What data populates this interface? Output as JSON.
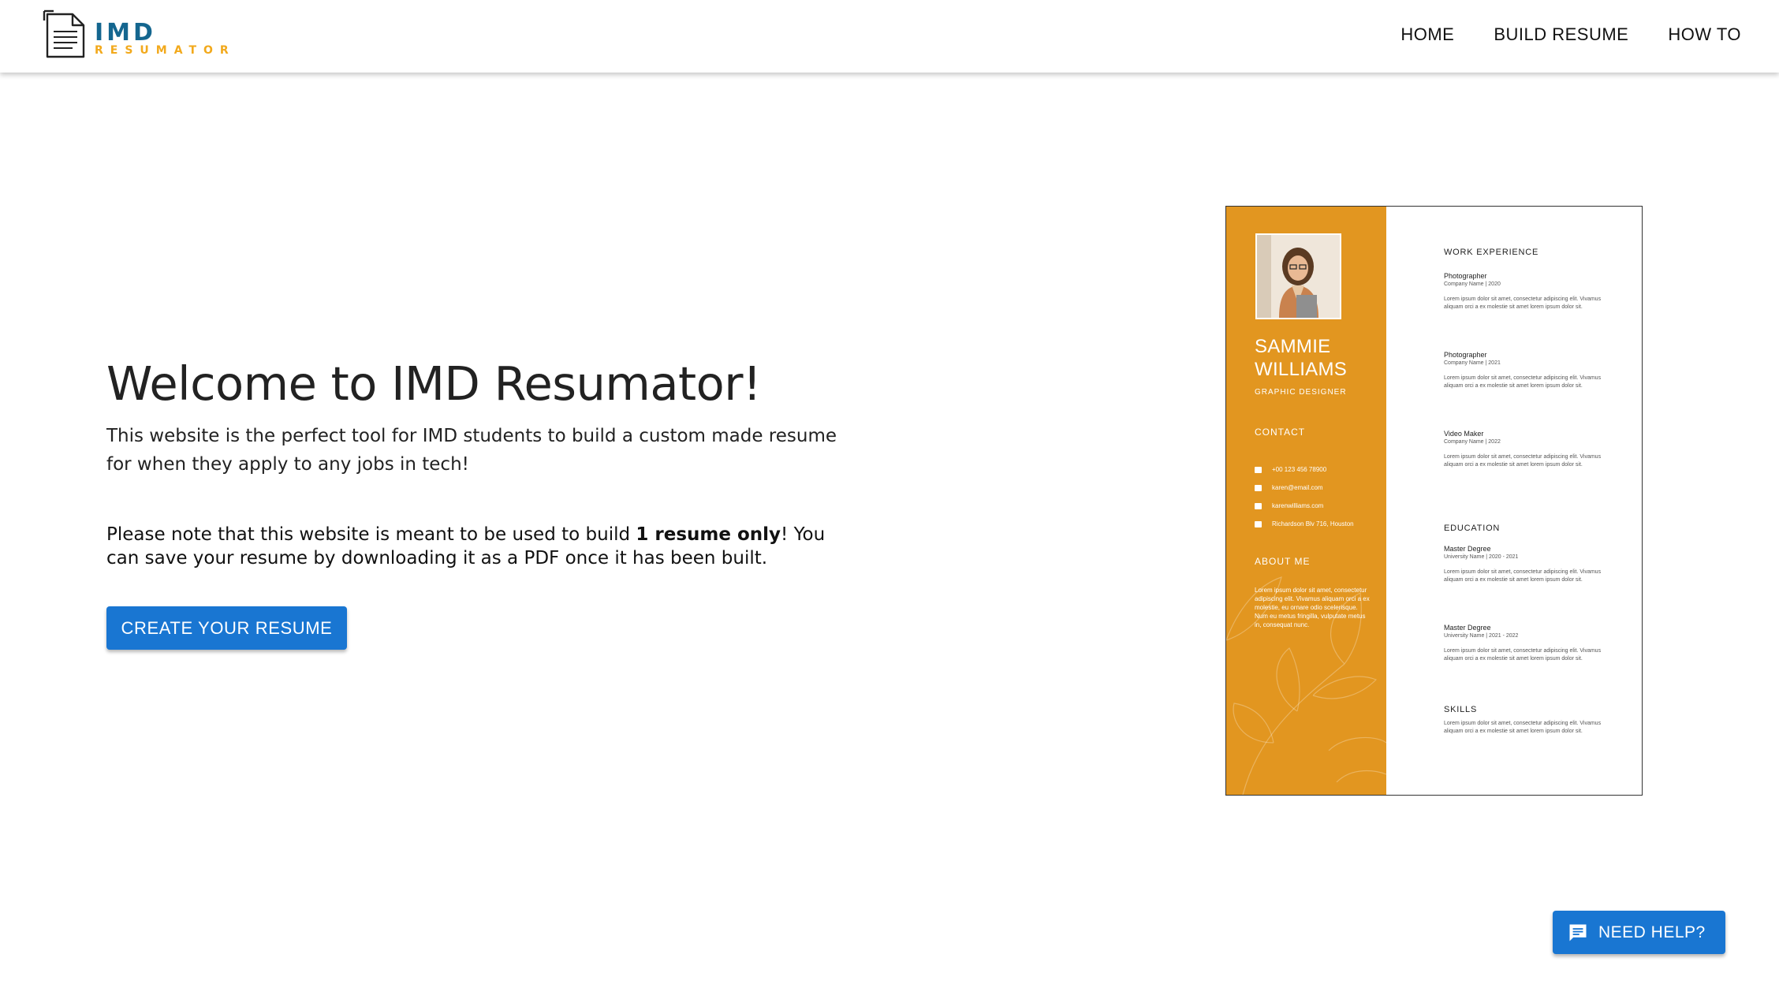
{
  "brand": {
    "name": "IMD",
    "subtitle": "RESUMATOR",
    "primary_color": "#14668f",
    "accent_color": "#f2a91c"
  },
  "nav": {
    "items": [
      {
        "label": "HOME"
      },
      {
        "label": "BUILD RESUME"
      },
      {
        "label": "HOW TO"
      }
    ]
  },
  "hero": {
    "title": "Welcome to IMD Resumator!",
    "description": "This website is the perfect tool for IMD students to build a custom made resume for when they apply to any jobs in tech!",
    "note_before": "Please note that this website is meant to be used to build ",
    "note_bold": "1 resume only",
    "note_after": "! You can save your resume by downloading it as a PDF once it has been built.",
    "cta_label": "CREATE YOUR RESUME",
    "cta_color": "#1976d2"
  },
  "resume_preview": {
    "sidebar_color": "#e29620",
    "name": "SAMMIE WILLIAMS",
    "role": "GRAPHIC DESIGNER",
    "contact_heading": "CONTACT",
    "contact": [
      {
        "icon": "phone-icon",
        "text": "+00 123 456 78900"
      },
      {
        "icon": "mail-icon",
        "text": "karen@email.com"
      },
      {
        "icon": "web-icon",
        "text": "karenwilliams.com"
      },
      {
        "icon": "home-icon",
        "text": "Richardson Blv 716, Houston"
      }
    ],
    "about_heading": "ABOUT ME",
    "about": "Lorem ipsum dolor sit amet, consectetur adipiscing elit. Vivamus aliquam orci a ex molestie, eu ornare odio scelerisque. Num eu metus fringilla, vulputate metus in, consequat nunc.",
    "work_heading": "WORK EXPERIENCE",
    "work": [
      {
        "title": "Photographer",
        "sub": "Company Name  |  2020",
        "text": "Lorem ipsum dolor sit amet, consectetur adipiscing elit. Vivamus aliquam orci a ex molestie sit amet lorem ipsum dolor sit."
      },
      {
        "title": "Photographer",
        "sub": "Company Name  |  2021",
        "text": "Lorem ipsum dolor sit amet, consectetur adipiscing elit. Vivamus aliquam orci a ex molestie sit amet lorem ipsum dolor sit."
      },
      {
        "title": "Video Maker",
        "sub": "Company Name  |  2022",
        "text": "Lorem ipsum dolor sit amet, consectetur adipiscing elit. Vivamus aliquam orci a ex molestie sit amet lorem ipsum dolor sit."
      }
    ],
    "education_heading": "EDUCATION",
    "education": [
      {
        "title": "Master Degree",
        "sub": "University Name  |  2020 - 2021",
        "text": "Lorem ipsum dolor sit amet, consectetur adipiscing elit. Vivamus aliquam orci a ex molestie sit amet lorem ipsum dolor sit."
      },
      {
        "title": "Master Degree",
        "sub": "University Name  |  2021 - 2022",
        "text": "Lorem ipsum dolor sit amet, consectetur adipiscing elit. Vivamus aliquam orci a ex molestie sit amet lorem ipsum dolor sit."
      }
    ],
    "skills_heading": "SKILLS",
    "skills_text": "Lorem ipsum dolor sit amet, consectetur adipiscing elit. Vivamus aliquam orci a ex molestie sit amet lorem ipsum dolor sit."
  },
  "help": {
    "label": "NEED HELP?",
    "icon": "chat-icon"
  }
}
